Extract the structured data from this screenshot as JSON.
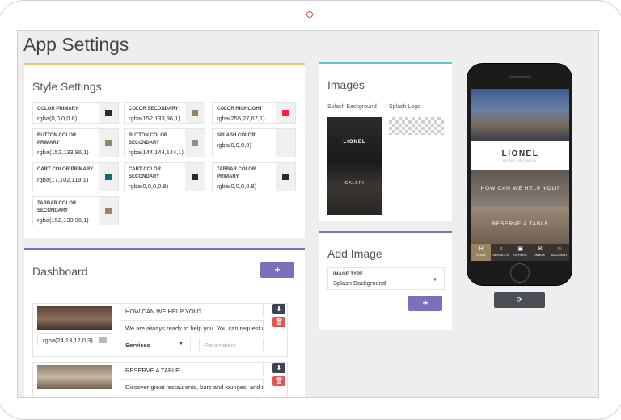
{
  "page": {
    "title": "App Settings"
  },
  "style_settings": {
    "title": "Style Settings",
    "fields": [
      {
        "label": "COLOR PRIMARY",
        "value": "rgba(0,0,0,0.8)",
        "swatch": "#2a2a2a"
      },
      {
        "label": "COLOR SECONDARY",
        "value": "rgba(152,133,96,1)",
        "swatch": "#988560"
      },
      {
        "label": "COLOR HIGHLIGHT",
        "value": "rgba(255,27,67,1)",
        "swatch": "#ff1b43"
      },
      {
        "label": "BUTTON COLOR PRIMARY",
        "value": "rgba(152,133,96,1)",
        "swatch": "#988560"
      },
      {
        "label": "BUTTON COLOR SECONDARY",
        "value": "rgba(144,144,144,1)",
        "swatch": "#909090"
      },
      {
        "label": "SPLASH COLOR",
        "value": "rgba(0,0,0,0)",
        "swatch": ""
      },
      {
        "label": "CART COLOR PRIMARY",
        "value": "rgba(17,102,119,1)",
        "swatch": "#116677"
      },
      {
        "label": "CART COLOR SECONDARY",
        "value": "rgba(0,0,0,0.8)",
        "swatch": "#2a2a2a"
      },
      {
        "label": "TABBAR COLOR PRIMARY",
        "value": "rgba(0,0,0,0.8)",
        "swatch": "#2a2a2a"
      },
      {
        "label": "TABBAR COLOR SECONDARY",
        "value": "rgba(152,133,96,1)",
        "swatch": "#988560"
      }
    ]
  },
  "images": {
    "title": "Images",
    "splash_background_label": "Splash Background",
    "splash_logo_label": "Splash Logo",
    "splash_brand": "LIONEL",
    "splash_brand_sub": "GALERI"
  },
  "add_image": {
    "title": "Add Image",
    "type_label": "IMAGE TYPE",
    "type_value": "Splash Background",
    "add_label": "+"
  },
  "dashboard": {
    "title": "Dashboard",
    "add_label": "+",
    "items": [
      {
        "title": "HOW CAN WE HELP YOU?",
        "description": "We are always ready to help you. You can request wh",
        "color": "rgba(24,13,12,0.3)",
        "type": "Services",
        "params_placeholder": "Parameters"
      },
      {
        "title": "RESERVE A TABLE",
        "description": "Discover great restaurants, bars and lounges, and res"
      }
    ]
  },
  "preview": {
    "brand": "LIONEL",
    "brand_sub": "HOTEL ISTANBUL",
    "tiles": [
      "HOW CAN WE HELP YOU?",
      "RESERVE A TABLE"
    ],
    "tabs": [
      {
        "label": "HOME",
        "icon": "home-icon",
        "glyph": "H"
      },
      {
        "label": "SERVICES",
        "icon": "bell-icon",
        "glyph": "♫"
      },
      {
        "label": "OFFERS",
        "icon": "gift-icon",
        "glyph": "▣"
      },
      {
        "label": "INBOX",
        "icon": "mail-icon",
        "glyph": "✉"
      },
      {
        "label": "ACCOUNT",
        "icon": "user-icon",
        "glyph": "☺"
      }
    ],
    "refresh_glyph": "⟳"
  }
}
